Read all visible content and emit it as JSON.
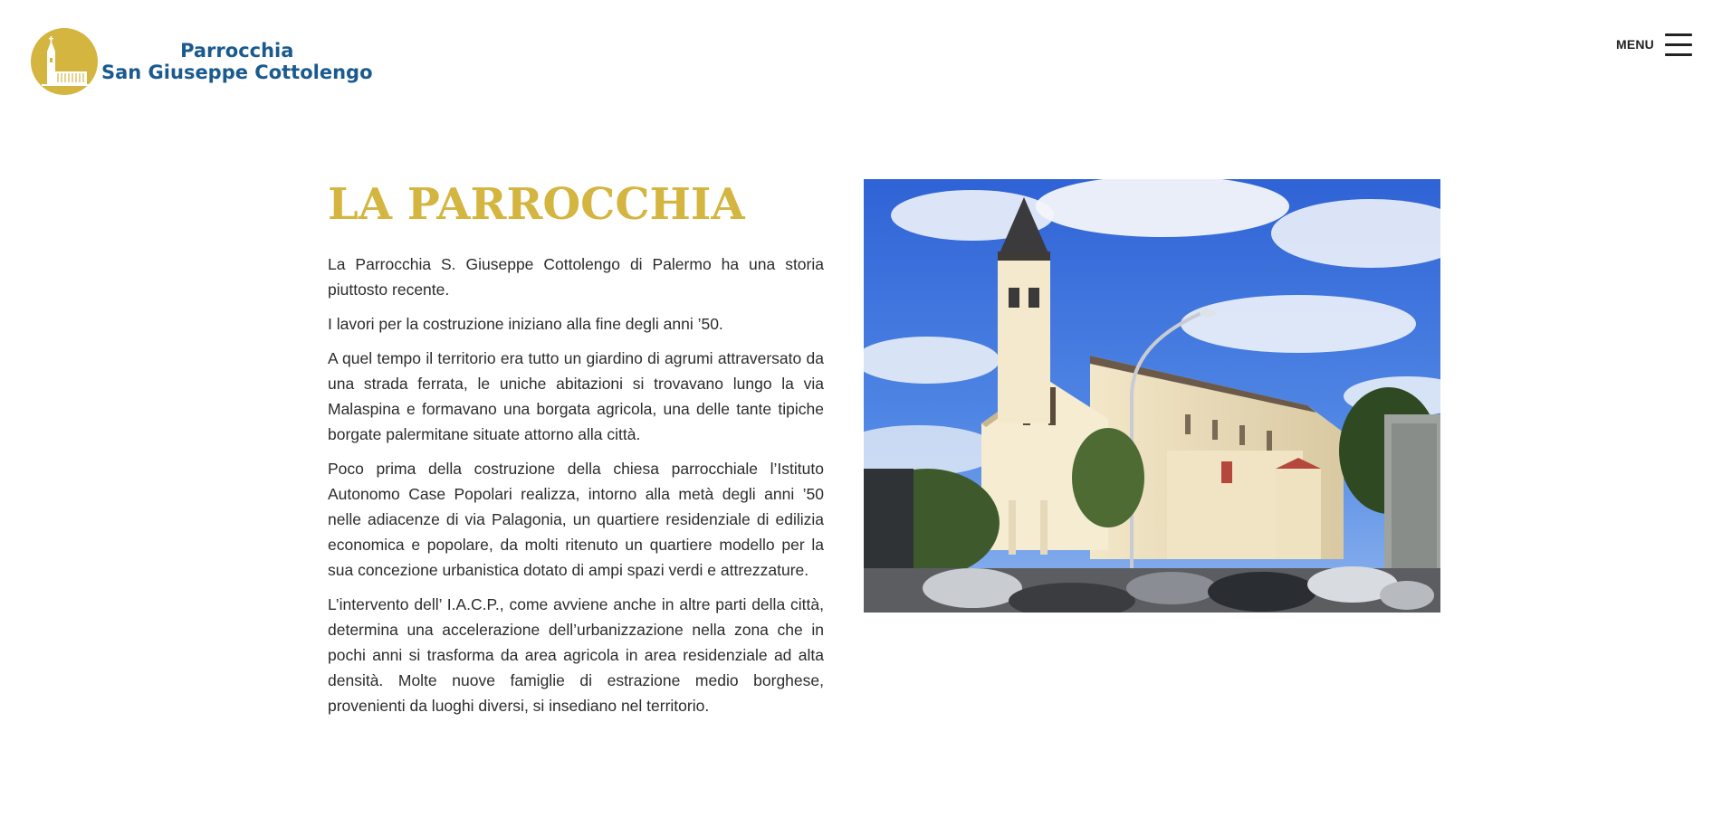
{
  "header": {
    "logo": {
      "line1": "Parrocchia",
      "line2": "San Giuseppe Cottolengo"
    },
    "menu_label": "MENU",
    "menu_icon": "hamburger-icon"
  },
  "main": {
    "title": "LA PARROCCHIA",
    "paragraphs": [
      "La Parrocchia S. Giuseppe Cottolengo di Palermo ha una storia piuttosto recente.",
      "I lavori per la costruzione iniziano alla fine degli anni ’50.",
      "A quel tempo il territorio era tutto un giardino di agrumi attraversato da una strada ferrata, le uniche abitazioni si trovavano lungo la via Malaspina e formavano una borgata agricola, una delle tante tipiche borgate palermitane situate attorno alla città.",
      "Poco prima della costruzione della chiesa parrocchiale l’Istituto Autonomo Case Popolari realizza, intorno alla metà degli anni ’50 nelle adiacenze di via Palagonia, un quartiere residenziale di edilizia economica e popolare, da molti ritenuto un quartiere modello per la sua concezione urbanistica dotato di ampi spazi verdi e attrezzature.",
      "L’intervento dell’ I.A.C.P., come avviene anche in altre parti della città, determina una accelerazione dell’urbanizzazione nella zona che in pochi anni si trasforma da area agricola in area residenziale ad alta densità. Molte nuove famiglie di estrazione medio borghese, provenienti da luoghi diversi, si insediano nel territorio."
    ]
  },
  "colors": {
    "brand_gold": "#d4b540",
    "brand_blue": "#1b5a8e",
    "text": "#2c2c2c"
  }
}
